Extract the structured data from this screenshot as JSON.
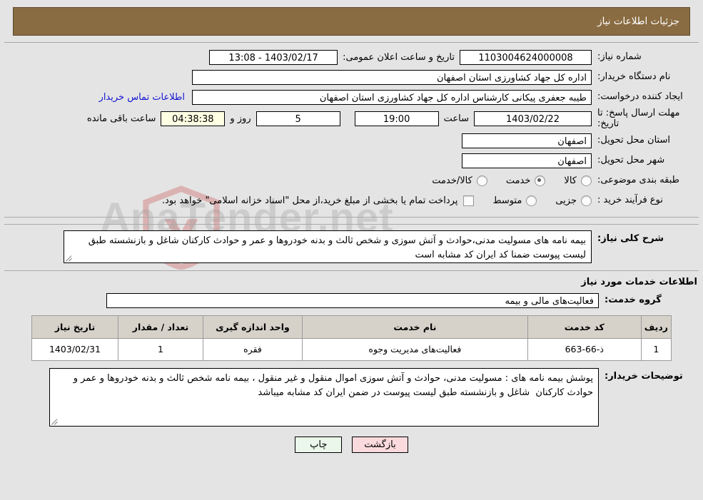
{
  "header": {
    "title": "جزئیات اطلاعات نیاز"
  },
  "summary": {
    "need_number_label": "شماره نیاز:",
    "need_number_value": "1103004624000008",
    "public_announce_label": "تاریخ و ساعت اعلان عمومی:",
    "public_announce_value": "13:08 - 1403/02/17",
    "buyer_org_label": "نام دستگاه خریدار:",
    "buyer_org_value": "اداره کل جهاد کشاورزی استان اصفهان",
    "creator_label": "ایجاد کننده درخواست:",
    "creator_value": "طیبه جعفری پیکانی کارشناس اداره کل جهاد کشاورزی استان اصفهان",
    "contact_link": "اطلاعات تماس خریدار",
    "deadline_label": "مهلت ارسال پاسخ: تا تاریخ:",
    "deadline_date": "1403/02/22",
    "hour_label": "ساعت",
    "deadline_time": "19:00",
    "days_value": "5",
    "days_label": "روز و",
    "remaining_value": "04:38:38",
    "remaining_label": "ساعت باقی مانده",
    "province_label": "استان محل تحویل:",
    "province_value": "اصفهان",
    "city_label": "شهر محل تحویل:",
    "city_value": "اصفهان",
    "category_label": "طبقه بندی موضوعی:",
    "category_options": [
      {
        "label": "کالا",
        "selected": false
      },
      {
        "label": "خدمت",
        "selected": true
      },
      {
        "label": "کالا/خدمت",
        "selected": false
      }
    ],
    "process_label": "نوع فرآیند خرید :",
    "process_options": [
      {
        "label": "جزیی",
        "selected": false
      },
      {
        "label": "متوسط",
        "selected": false
      }
    ],
    "treasury_checkbox_label": "پرداخت تمام یا بخشی از مبلغ خرید،از محل \"اسناد خزانه اسلامی\" خواهد بود.",
    "treasury_checked": false
  },
  "general_need": {
    "label": "شرح کلی نیاز:",
    "text": "بیمه نامه های مسولیت مدنی،حوادث و آتش سوزی و شخص ثالث و بدنه خودروها و عمر و حوادث کارکنان شاغل و بازنشسته طبق لیست پیوست ضمنا کد ایران کد مشابه است"
  },
  "services_section": {
    "heading": "اطلاعات خدمات مورد نیاز",
    "group_label": "گروه خدمت:",
    "group_value": "فعالیت‌های مالی و بیمه",
    "table": {
      "columns": [
        "ردیف",
        "کد خدمت",
        "نام خدمت",
        "واحد اندازه گیری",
        "تعداد / مقدار",
        "تاریخ نیاز"
      ],
      "rows": [
        {
          "index": "1",
          "service_code": "ذ-66-663",
          "service_name": "فعالیت‌های مدیریت وجوه",
          "unit": "فقره",
          "quantity": "1",
          "need_date": "1403/02/31"
        }
      ]
    }
  },
  "buyer_notes": {
    "label": "توضیحات خریدار:",
    "text": "پوشش بیمه نامه های : مسولیت مدنی، حوادث و آتش سوزی اموال منقول و غیر منقول ، بیمه نامه شخص ثالث و بدنه خودروها و عمر و حوادث کارکنان  شاغل و بازنشسته طبق لیست پیوست در ضمن ایران کد مشابه میباشد"
  },
  "footer": {
    "print_label": "چاپ",
    "back_label": "بازگشت"
  },
  "watermark": {
    "text": "AnaTender.net"
  },
  "colors": {
    "header_bg": "#8a6c42",
    "link": "#1414d2",
    "table_header_bg": "#d6d2ca",
    "print_btn_bg": "#eaf7ea",
    "back_btn_bg": "#fadadd",
    "countdown_bg": "#ffffe4"
  }
}
